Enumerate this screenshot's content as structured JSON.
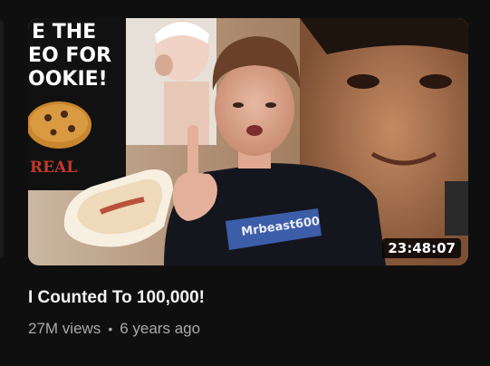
{
  "video": {
    "title": "I Counted To 100,000!",
    "duration": "23:48:07",
    "views": "27M views",
    "separator": "•",
    "age": "6 years ago"
  },
  "thumbnail": {
    "poster_lines": [
      "E THE",
      "EO FOR",
      "OOKIE!"
    ],
    "poster_tag": "REAL",
    "shirt_text": "Mrbeast600"
  },
  "colors": {
    "background": "#0f0f0f",
    "title": "#f1f1f1",
    "subtext": "#aaaaaa",
    "badge_bg": "#000000"
  }
}
